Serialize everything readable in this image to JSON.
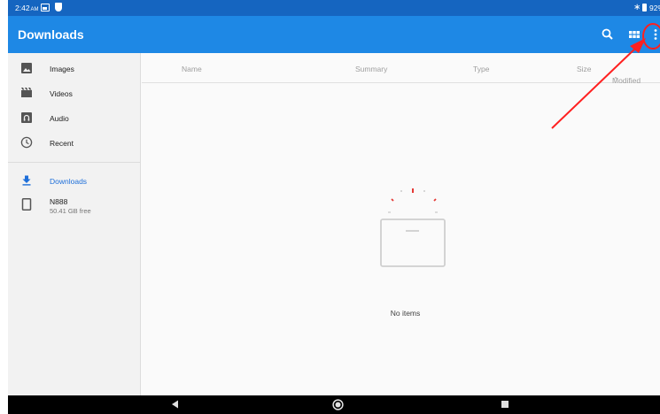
{
  "status_bar": {
    "time": "2:42",
    "time_suffix": "AM",
    "battery_text": "92%"
  },
  "app_bar": {
    "title": "Downloads",
    "actions": [
      "search-icon",
      "grid-view-icon",
      "more-vert-icon"
    ]
  },
  "sidebar": {
    "items": [
      {
        "label": "Images",
        "icon": "image-icon"
      },
      {
        "label": "Videos",
        "icon": "film-icon"
      },
      {
        "label": "Audio",
        "icon": "audio-icon"
      },
      {
        "label": "Recent",
        "icon": "clock-icon"
      }
    ],
    "downloads": {
      "label": "Downloads",
      "icon": "download-icon",
      "active": true
    },
    "device": {
      "label": "N888",
      "sub": "50.41 GB free",
      "icon": "phone-icon"
    }
  },
  "columns": {
    "name": "Name",
    "summary": "Summary",
    "type": "Type",
    "size": "Size",
    "modified": "Modified",
    "modified_sort": "^"
  },
  "empty_state": {
    "message": "No items"
  },
  "colors": {
    "status_bar": "#1565c0",
    "app_bar": "#1e88e5",
    "active_nav": "#1e6fd9",
    "sidebar_bg": "#f2f2f2",
    "annotation": "#ff2020"
  }
}
